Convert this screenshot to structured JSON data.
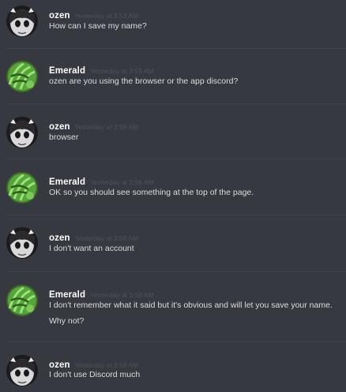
{
  "messages": [
    {
      "author": "ozen",
      "avatar": "ozen-avatar-icon",
      "timestamp": "Yesterday at 3:53 AM",
      "lines": [
        "How can I save my name?"
      ]
    },
    {
      "author": "Emerald",
      "avatar": "emerald-avatar-icon",
      "timestamp": "Yesterday at 3:55 AM",
      "lines": [
        "ozen are you using the browser or the app discord?"
      ]
    },
    {
      "author": "ozen",
      "avatar": "ozen-avatar-icon",
      "timestamp": "Yesterday at 3:58 AM",
      "lines": [
        "browser"
      ]
    },
    {
      "author": "Emerald",
      "avatar": "emerald-avatar-icon",
      "timestamp": "Yesterday at 3:58 AM",
      "lines": [
        "OK so you should see something at the top of the page."
      ]
    },
    {
      "author": "ozen",
      "avatar": "ozen-avatar-icon",
      "timestamp": "Yesterday at 3:58 AM",
      "lines": [
        "I don't want an account"
      ]
    },
    {
      "author": "Emerald",
      "avatar": "emerald-avatar-icon",
      "timestamp": "Yesterday at 3:58 AM",
      "lines": [
        "I don't remember what it said but it's obvious and will let you save your name.",
        "Why not?"
      ]
    },
    {
      "author": "ozen",
      "avatar": "ozen-avatar-icon",
      "timestamp": "Yesterday at 3:58 AM",
      "lines": [
        "I don't use Discord much"
      ]
    }
  ],
  "colors": {
    "background": "#36393f",
    "username": "#ffffff",
    "timestamp": "#4f5258",
    "message_text": "#dcddde",
    "divider": "#40434a"
  }
}
